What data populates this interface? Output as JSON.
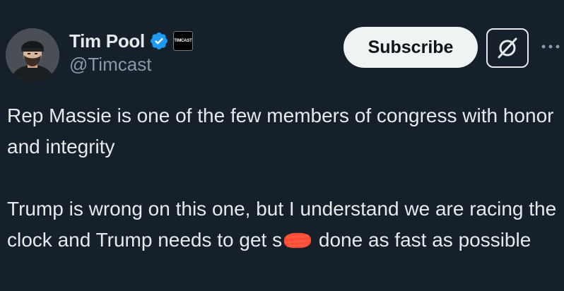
{
  "author": {
    "display_name": "Tim Pool",
    "handle": "@Timcast",
    "avatar_icon": "profile-photo",
    "verified_icon": "blue-verified-checkmark",
    "affiliate_badge_text": "TIMCAST"
  },
  "actions": {
    "subscribe_label": "Subscribe",
    "grok_icon": "grok-slash-icon",
    "more_icon": "more-horizontal-icon"
  },
  "tweet": {
    "paragraph_1": "Rep Massie is one of the few members of congress with honor and integrity",
    "paragraph_2_before": "Trump is wrong on this one, but I understand we are racing the clock and Trump needs to get s",
    "paragraph_2_after": " done as fast as possible"
  },
  "colors": {
    "background": "#15202b",
    "text": "#e7e9ea",
    "secondary_text": "#8b98a5",
    "verified": "#1d9bf0",
    "redaction": "#ff4a36"
  }
}
